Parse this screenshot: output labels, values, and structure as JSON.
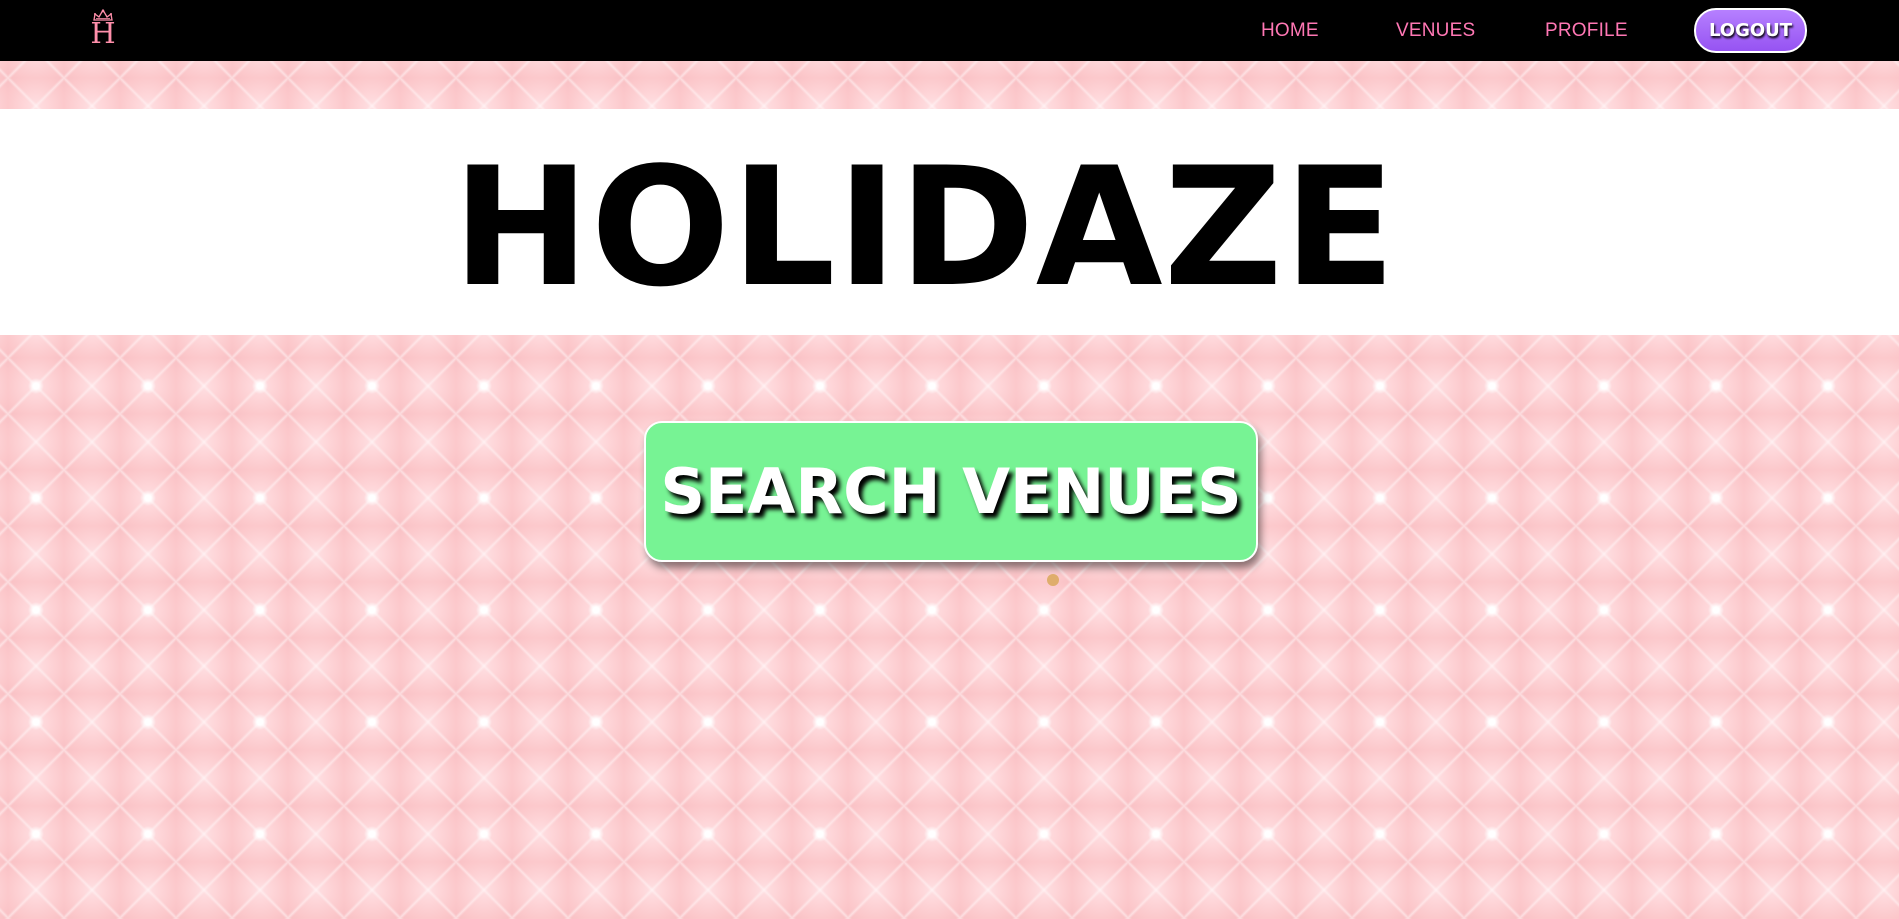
{
  "brand": {
    "logo_letter": "H",
    "logo_icon": "tiara-icon",
    "logo_color": "#ff8fab"
  },
  "nav": {
    "items": [
      {
        "label": "HOME"
      },
      {
        "label": "VENUES"
      },
      {
        "label": "PROFILE"
      }
    ],
    "logout_label": "LOGOUT",
    "link_color": "#ff77b4",
    "logout_color": "#9b5cf5"
  },
  "hero": {
    "title": "HOLIDAZE"
  },
  "cta": {
    "label": "SEARCH VENUES",
    "color": "#77f394"
  },
  "colors": {
    "navbar": "#000000",
    "background": "#ffd3d6",
    "hero_band": "#ffffff"
  }
}
